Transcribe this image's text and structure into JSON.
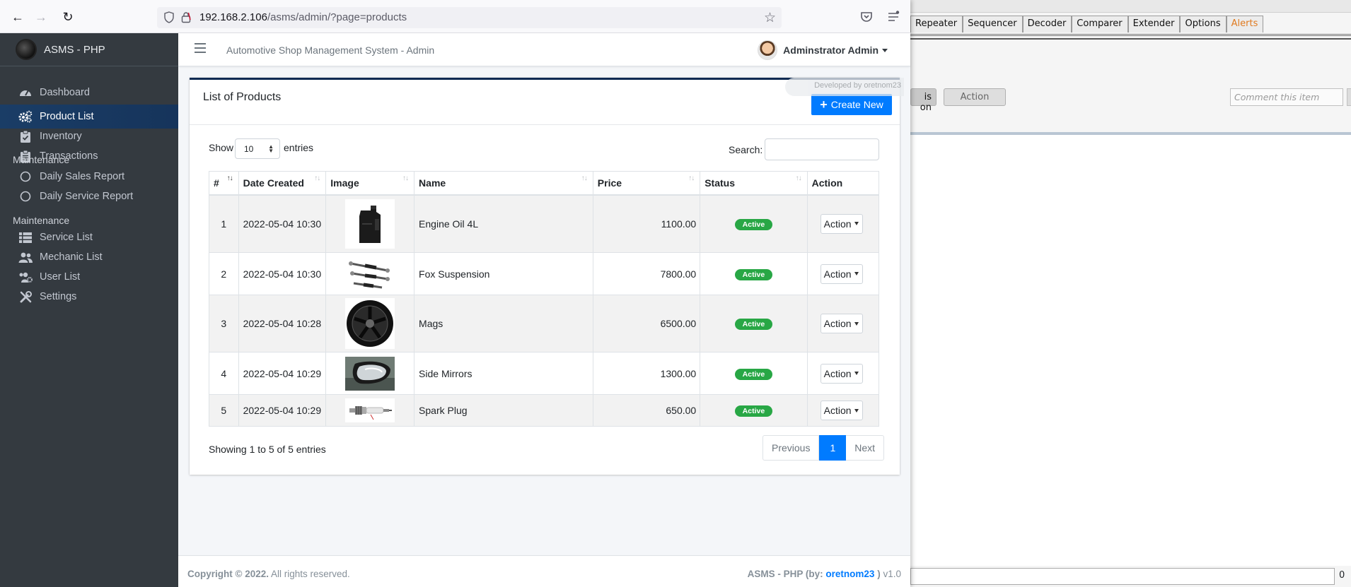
{
  "browser": {
    "url_host": "192.168.2.106",
    "url_path": "/asms/admin/?page=products"
  },
  "sidebar": {
    "brand": "ASMS - PHP",
    "items": [
      {
        "label": "Dashboard",
        "icon": "tachometer-icon"
      },
      {
        "label": "Product List",
        "icon": "cogs-icon",
        "active": true
      },
      {
        "label": "Inventory",
        "icon": "clipboard-check-icon"
      },
      {
        "label": "Transactions",
        "icon": "clipboard-list-icon"
      }
    ],
    "section1": "Maintenance",
    "reports": [
      {
        "label": "Daily Sales Report",
        "icon": "circle-icon"
      },
      {
        "label": "Daily Service Report",
        "icon": "circle-icon"
      }
    ],
    "section2": "Maintenance",
    "maintenance": [
      {
        "label": "Service List",
        "icon": "list-icon"
      },
      {
        "label": "Mechanic List",
        "icon": "users-icon"
      },
      {
        "label": "User List",
        "icon": "users-cog-icon"
      },
      {
        "label": "Settings",
        "icon": "tools-icon"
      }
    ]
  },
  "header": {
    "title": "Automotive Shop Management System - Admin",
    "user": "Adminstrator Admin"
  },
  "dev_badge": "Developed by oretnom23",
  "card": {
    "title": "List of Products",
    "create_label": "Create New",
    "show_label": "Show",
    "entries_value": "10",
    "entries_label": "entries",
    "search_label": "Search:",
    "columns": [
      "#",
      "Date Created",
      "Image",
      "Name",
      "Price",
      "Status",
      "Action"
    ],
    "rows": [
      {
        "num": "1",
        "date": "2022-05-04 10:30",
        "image": "engine-oil-image",
        "name": "Engine Oil 4L",
        "price": "1100.00",
        "status": "Active",
        "action": "Action"
      },
      {
        "num": "2",
        "date": "2022-05-04 10:30",
        "image": "suspension-image",
        "name": "Fox Suspension",
        "price": "7800.00",
        "status": "Active",
        "action": "Action"
      },
      {
        "num": "3",
        "date": "2022-05-04 10:28",
        "image": "mags-image",
        "name": "Mags",
        "price": "6500.00",
        "status": "Active",
        "action": "Action"
      },
      {
        "num": "4",
        "date": "2022-05-04 10:29",
        "image": "side-mirror-image",
        "name": "Side Mirrors",
        "price": "1300.00",
        "status": "Active",
        "action": "Action"
      },
      {
        "num": "5",
        "date": "2022-05-04 10:29",
        "image": "spark-plug-image",
        "name": "Spark Plug",
        "price": "650.00",
        "status": "Active",
        "action": "Action"
      }
    ],
    "info": "Showing 1 to 5 of 5 entries",
    "pager": {
      "prev": "Previous",
      "current": "1",
      "next": "Next"
    }
  },
  "footer": {
    "copyright": "Copyright © 2022.",
    "rights": "All rights reserved.",
    "app": "ASMS - PHP (by:",
    "author": "oretnom23",
    "close": ")",
    "version": "v1.0"
  },
  "rightapp": {
    "tabs": [
      "Repeater",
      "Sequencer",
      "Decoder",
      "Comparer",
      "Extender",
      "Options",
      "Alerts"
    ],
    "btn_on": "is on",
    "btn_action": "Action",
    "comment_placeholder": "Comment this item",
    "bottom_num": "0"
  },
  "colors": {
    "accent": "#007bff",
    "sidebar": "#343a40",
    "active_nav": "#1a3d66",
    "badge": "#28a745",
    "alert_tab": "#e07a1f"
  }
}
